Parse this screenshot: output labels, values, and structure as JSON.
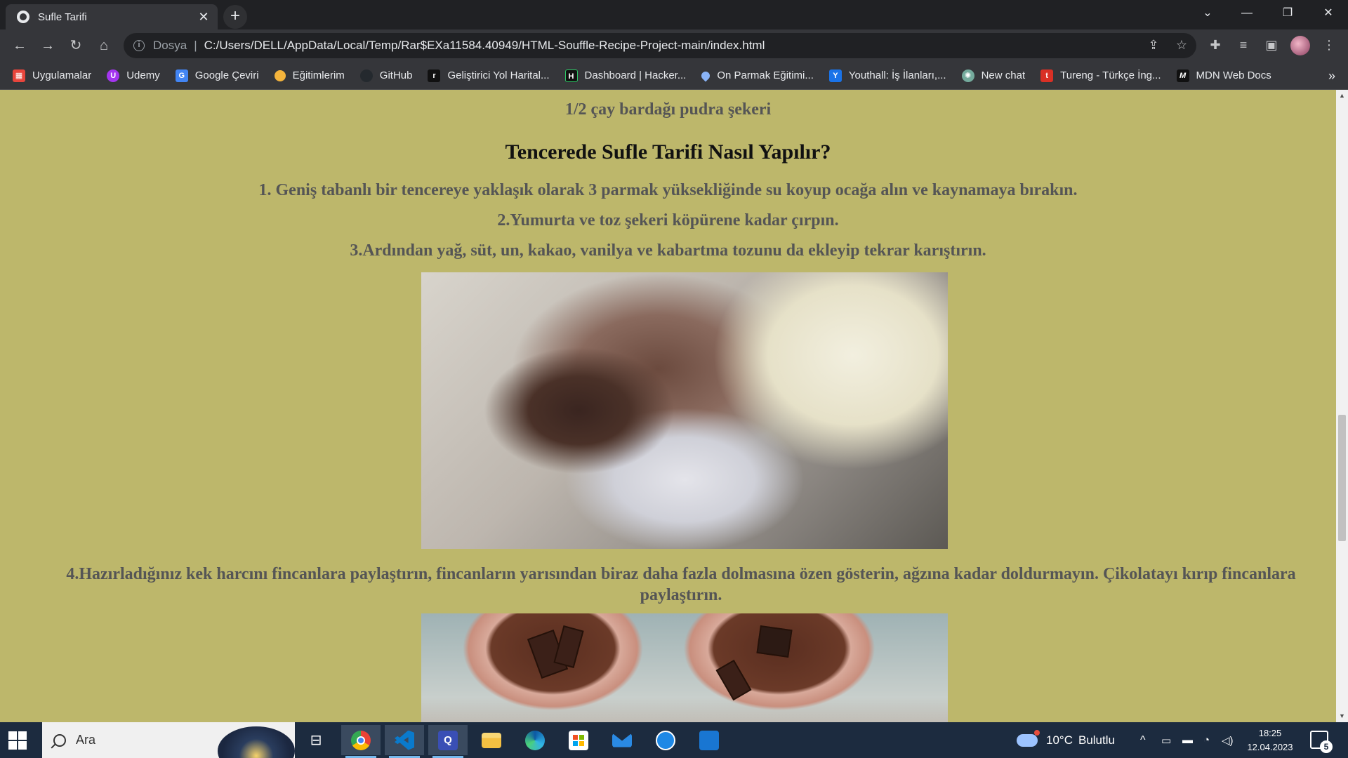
{
  "browser": {
    "tab": {
      "title": "Sufle Tarifi"
    },
    "new_tab_symbol": "+",
    "address": {
      "scheme_label": "Dosya",
      "url": "C:/Users/DELL/AppData/Local/Temp/Rar$EXa11584.40949/HTML-Souffle-Recipe-Project-main/index.html"
    },
    "bookmarks": [
      {
        "label": "Uygulamalar",
        "icon": "apps-grid-icon",
        "color": "#e8453c"
      },
      {
        "label": "Udemy",
        "icon": "udemy-icon",
        "color": "#a435f0"
      },
      {
        "label": "Google Çeviri",
        "icon": "google-translate-icon",
        "color": "#4285f4"
      },
      {
        "label": "Eğitimlerim",
        "icon": "circle-icon",
        "color": "#f4b43c"
      },
      {
        "label": "GitHub",
        "icon": "github-icon",
        "color": "#24292e"
      },
      {
        "label": "Geliştirici Yol Harital...",
        "icon": "roadmap-icon",
        "color": "#111111"
      },
      {
        "label": "Dashboard | Hacker...",
        "icon": "hackerrank-icon",
        "color": "#111111"
      },
      {
        "label": "On Parmak Eğitimi...",
        "icon": "drop-icon",
        "color": "#8ab4f8"
      },
      {
        "label": "Youthall: İş İlanları,...",
        "icon": "youthall-icon",
        "color": "#1a73e8"
      },
      {
        "label": "New chat",
        "icon": "openai-icon",
        "color": "#74aa9c"
      },
      {
        "label": "Tureng - Türkçe İng...",
        "icon": "tureng-icon",
        "color": "#d93025"
      },
      {
        "label": "MDN Web Docs",
        "icon": "mdn-icon",
        "color": "#111111"
      }
    ],
    "bookmarks_more": "»"
  },
  "page": {
    "top_line": "1/2 çay bardağı pudra şekeri",
    "heading": "Tencerede Sufle Tarifi Nasıl Yapılır?",
    "steps": [
      "1. Geniş tabanlı bir tencereye yaklaşık olarak 3 parmak yüksekliğinde su koyup ocağa alın ve kaynamaya bırakın.",
      "2.Yumurta ve toz şekeri köpürene kadar çırpın.",
      "3.Ardından yağ, süt, un, kakao, vanilya ve kabartma tozunu da ekleyip tekrar karıştırın.",
      "4.Hazırladığınız kek harcını fincanlara paylaştırın, fincanların yarısından biraz daha fazla dolmasına özen gösterin, ağzına kadar doldurmayın. Çikolatayı kırıp fincanlara paylaştırın."
    ],
    "background_color": "#bdb76b"
  },
  "taskbar": {
    "search_placeholder": "Ara",
    "weather": {
      "temp": "10°C",
      "condition": "Bulutlu"
    },
    "clock": {
      "time": "18:25",
      "date": "12.04.2023"
    },
    "notification_count": "5"
  }
}
